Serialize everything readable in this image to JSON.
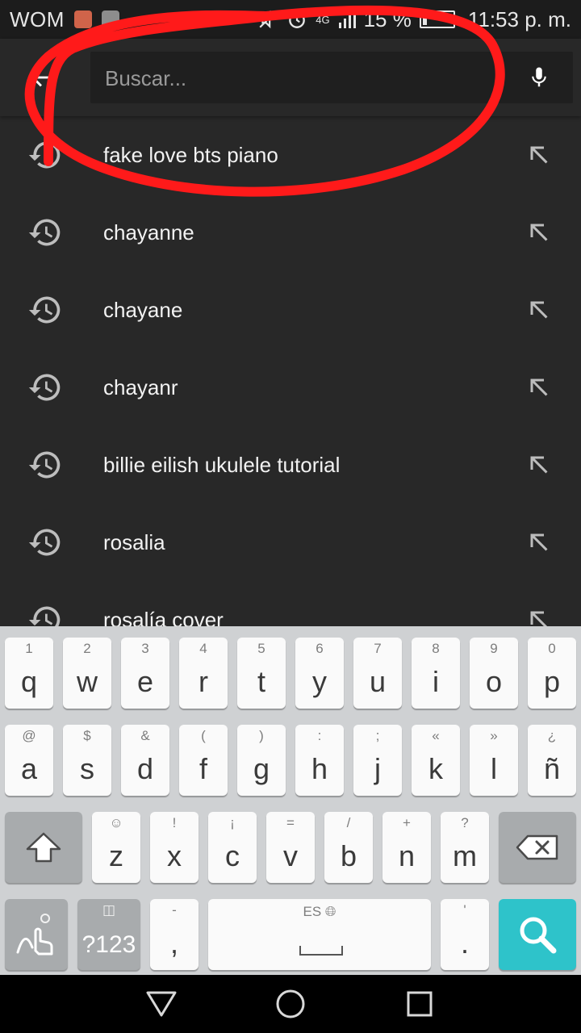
{
  "status_bar": {
    "carrier": "WOM",
    "network": "4G",
    "battery_text": "15 %",
    "battery_level": 0.15,
    "time": "11:53 p. m."
  },
  "search": {
    "placeholder": "Buscar...",
    "value": ""
  },
  "suggestions": [
    {
      "text": "fake love bts piano"
    },
    {
      "text": "chayanne"
    },
    {
      "text": "chayane"
    },
    {
      "text": "chayanr"
    },
    {
      "text": "billie eilish ukulele tutorial"
    },
    {
      "text": "rosalia"
    },
    {
      "text": "rosalía cover"
    }
  ],
  "keyboard": {
    "row1": [
      {
        "main": "q",
        "sec": "1"
      },
      {
        "main": "w",
        "sec": "2"
      },
      {
        "main": "e",
        "sec": "3"
      },
      {
        "main": "r",
        "sec": "4"
      },
      {
        "main": "t",
        "sec": "5"
      },
      {
        "main": "y",
        "sec": "6"
      },
      {
        "main": "u",
        "sec": "7"
      },
      {
        "main": "i",
        "sec": "8"
      },
      {
        "main": "o",
        "sec": "9"
      },
      {
        "main": "p",
        "sec": "0"
      }
    ],
    "row2": [
      {
        "main": "a",
        "sec": "@"
      },
      {
        "main": "s",
        "sec": "$"
      },
      {
        "main": "d",
        "sec": "&"
      },
      {
        "main": "f",
        "sec": "("
      },
      {
        "main": "g",
        "sec": ")"
      },
      {
        "main": "h",
        "sec": ":"
      },
      {
        "main": "j",
        "sec": ";"
      },
      {
        "main": "k",
        "sec": "«"
      },
      {
        "main": "l",
        "sec": "»"
      },
      {
        "main": "ñ",
        "sec": "¿"
      }
    ],
    "row3": [
      {
        "main": "z",
        "sec": "☺"
      },
      {
        "main": "x",
        "sec": "!"
      },
      {
        "main": "c",
        "sec": "¡"
      },
      {
        "main": "v",
        "sec": "="
      },
      {
        "main": "b",
        "sec": "/"
      },
      {
        "main": "n",
        "sec": "+"
      },
      {
        "main": "m",
        "sec": "?"
      }
    ],
    "symbols_label": "?123",
    "comma": {
      "main": ",",
      "sec": "-"
    },
    "period": {
      "main": ".",
      "sec": "'"
    },
    "space_lang": "ES"
  },
  "colors": {
    "background": "#282828",
    "annotation": "#ff1a1a",
    "search_key": "#2ec3ca"
  },
  "icons": {
    "back": "arrow-left-icon",
    "mic": "microphone-icon",
    "history": "history-icon",
    "fill": "arrow-up-left-icon",
    "search": "search-icon",
    "shift": "shift-icon",
    "backspace": "backspace-icon"
  }
}
